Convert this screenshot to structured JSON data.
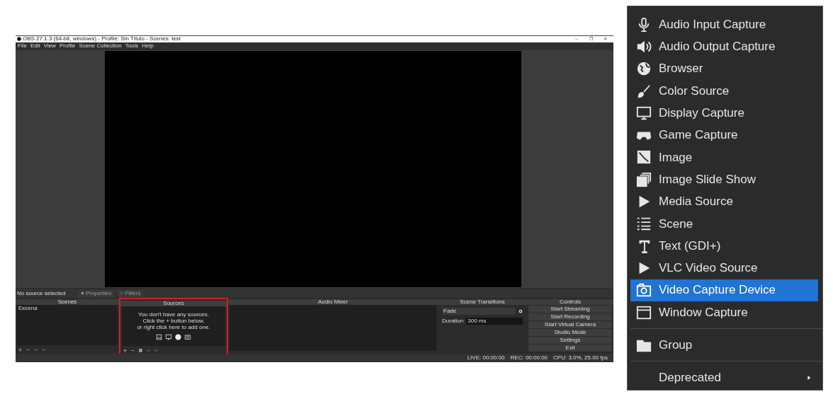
{
  "window": {
    "title": "OBS 27.1.3 (64-bit, windows) - Profile: Sin Título - Scenes: test",
    "controls": [
      "–",
      "❐",
      "✕"
    ]
  },
  "menu_bar": [
    "File",
    "Edit",
    "View",
    "Profile",
    "Scene Collection",
    "Tools",
    "Help"
  ],
  "source_toolbar": {
    "status": "No source selected",
    "buttons": [
      "Properties",
      "Filters"
    ]
  },
  "docks": {
    "scenes": {
      "title": "Scenes",
      "items": [
        {
          "label": "Escena",
          "selected": false
        }
      ]
    },
    "sources": {
      "title": "Sources",
      "empty_message": [
        "You don't have any sources.",
        "Click the + button below,",
        "or right click here to add one."
      ]
    },
    "audio_mixer": {
      "title": "Audio Mixer"
    },
    "transitions": {
      "title": "Scene Transitions",
      "transition": "Fade",
      "duration_label": "Duration",
      "duration": "300 ms"
    },
    "controls": {
      "title": "Controls",
      "buttons": [
        "Start Streaming",
        "Start Recording",
        "Start Virtual Camera",
        "Studio Mode",
        "Settings",
        "Exit"
      ]
    }
  },
  "status_bar": {
    "live": "LIVE: 00:00:00",
    "rec": "REC: 00:00:00",
    "cpu": "CPU: 3.0%, 25.00 fps"
  },
  "context_menu": [
    {
      "kind": "item",
      "label": "Audio Input Capture",
      "selected": false
    },
    {
      "kind": "item",
      "label": "Audio Output Capture",
      "selected": false
    },
    {
      "kind": "item",
      "label": "Browser",
      "selected": false
    },
    {
      "kind": "item",
      "label": "Color Source",
      "selected": false
    },
    {
      "kind": "item",
      "label": "Display Capture",
      "selected": false
    },
    {
      "kind": "item",
      "label": "Game Capture",
      "selected": false
    },
    {
      "kind": "item",
      "label": "Image",
      "selected": false
    },
    {
      "kind": "item",
      "label": "Image Slide Show",
      "selected": false
    },
    {
      "kind": "item",
      "label": "Media Source",
      "selected": false
    },
    {
      "kind": "item",
      "label": "Scene",
      "selected": false
    },
    {
      "kind": "item",
      "label": "Text (GDI+)",
      "selected": false
    },
    {
      "kind": "item",
      "label": "VLC Video Source",
      "selected": false
    },
    {
      "kind": "item",
      "label": "Video Capture Device",
      "selected": true
    },
    {
      "kind": "item",
      "label": "Window Capture",
      "selected": false
    },
    {
      "kind": "separator"
    },
    {
      "kind": "item",
      "label": "Group",
      "selected": false
    },
    {
      "kind": "separator"
    },
    {
      "kind": "submenu",
      "label": "Deprecated",
      "selected": false
    }
  ]
}
